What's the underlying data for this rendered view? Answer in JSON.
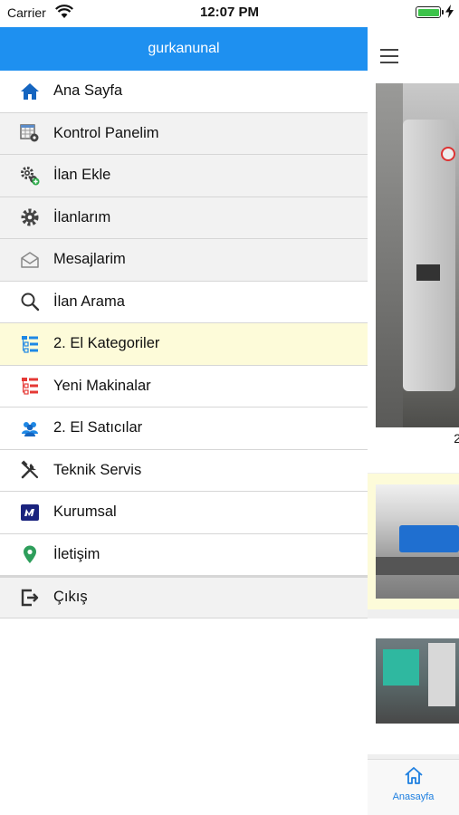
{
  "status_bar": {
    "carrier": "Carrier",
    "time": "12:07 PM"
  },
  "drawer": {
    "username": "gurkanunal",
    "items": [
      {
        "label": "Ana Sayfa",
        "icon": "home-icon",
        "color": "#1565c0"
      },
      {
        "label": "Kontrol Panelim",
        "icon": "control-panel-icon",
        "color": "#555555"
      },
      {
        "label": "İlan Ekle",
        "icon": "gear-add-icon",
        "color": "#444444"
      },
      {
        "label": "İlanlarım",
        "icon": "gear-icon",
        "color": "#444444"
      },
      {
        "label": "Mesajlarim",
        "icon": "envelope-icon",
        "color": "#888888"
      },
      {
        "label": "İlan Arama",
        "icon": "search-icon",
        "color": "#333333"
      },
      {
        "label": "2. El Kategoriler",
        "icon": "category-tree-icon",
        "color": "#1e88e5"
      },
      {
        "label": "Yeni Makinalar",
        "icon": "category-tree-red-icon",
        "color": "#e53935"
      },
      {
        "label": "2. El Satıcılar",
        "icon": "users-icon",
        "color": "#1e88e5"
      },
      {
        "label": "Teknik Servis",
        "icon": "tools-icon",
        "color": "#333333"
      },
      {
        "label": "Kurumsal",
        "icon": "company-logo-icon",
        "color": "#1a237e"
      },
      {
        "label": "İletişim",
        "icon": "location-pin-icon",
        "color": "#2e9e5b"
      },
      {
        "label": "Çıkış",
        "icon": "logout-icon",
        "color": "#333333"
      }
    ]
  },
  "content": {
    "card1_caption": "2",
    "tab_home_label": "Anasayfa"
  },
  "colors": {
    "header_blue": "#1e90f0",
    "active_row": "#fdfbd9",
    "tab_blue": "#1e7fe0"
  }
}
